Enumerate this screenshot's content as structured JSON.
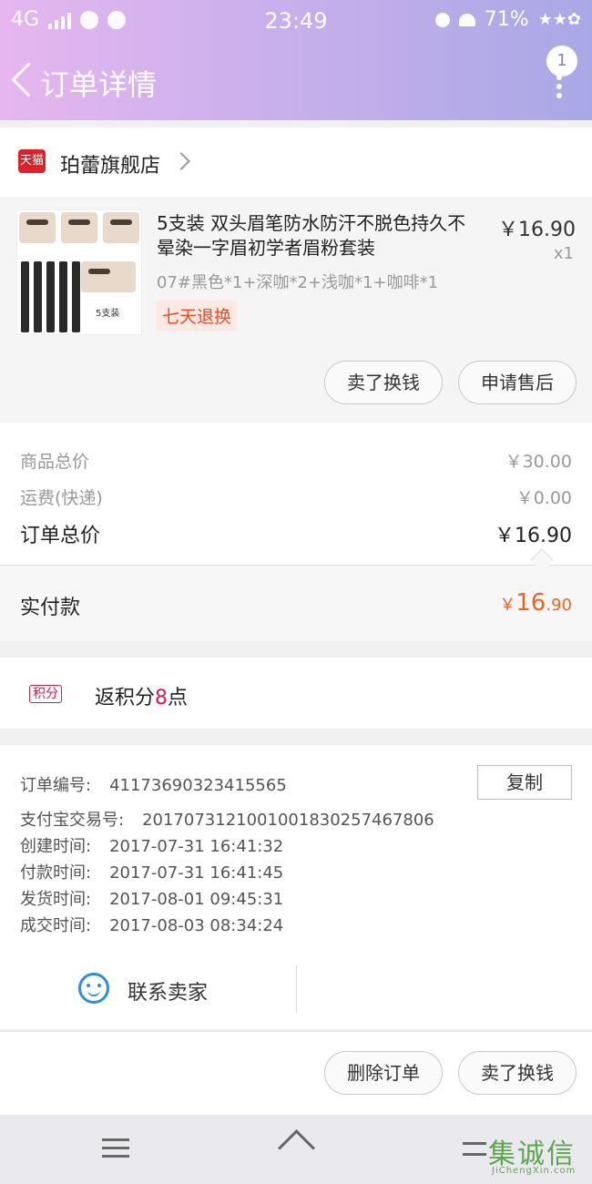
{
  "status_bar": {
    "network": "4G",
    "time": "23:49",
    "battery": "71%"
  },
  "header": {
    "title": "订单详情",
    "badge_count": "1"
  },
  "shop": {
    "badge": "天猫",
    "name": "珀蕾旗舰店"
  },
  "item": {
    "title": "5支装 双头眉笔防水防汗不脱色持久不晕染一字眉初学者眉粉套装",
    "price": "￥16.90",
    "qty": "x1",
    "sku": "07#黑色*1+深咖*2+浅咖*1+咖啡*1",
    "tag": "七天退换",
    "thumb_text": "5支装",
    "buttons": {
      "sell": "卖了换钱",
      "after_sale": "申请售后"
    }
  },
  "summary": {
    "goods_total_label": "商品总价",
    "goods_total": "￥30.00",
    "shipping_label": "运费(快递)",
    "shipping": "￥0.00",
    "order_total_label": "订单总价",
    "order_total": "￥16.90",
    "paid_label": "实付款",
    "paid_currency": "￥",
    "paid_int": "16",
    "paid_dec": ".90"
  },
  "points": {
    "badge": "积分",
    "prefix": "返积分",
    "value": "8",
    "suffix": "点"
  },
  "order_info": {
    "copy_label": "复制",
    "rows": [
      {
        "key": "订单编号:",
        "value": "41173690323415565"
      },
      {
        "key": "支付宝交易号:",
        "value": "2017073121001001830257467806"
      },
      {
        "key": "创建时间:",
        "value": "2017-07-31 16:41:32"
      },
      {
        "key": "付款时间:",
        "value": "2017-07-31 16:41:45"
      },
      {
        "key": "发货时间:",
        "value": "2017-08-01 09:45:31"
      },
      {
        "key": "成交时间:",
        "value": "2017-08-03 08:34:24"
      }
    ],
    "contact_label": "联系卖家"
  },
  "actions": {
    "delete": "删除订单",
    "sell": "卖了换钱"
  },
  "watermark": {
    "text": "集诚信",
    "sub": "JiChengXin.com"
  }
}
